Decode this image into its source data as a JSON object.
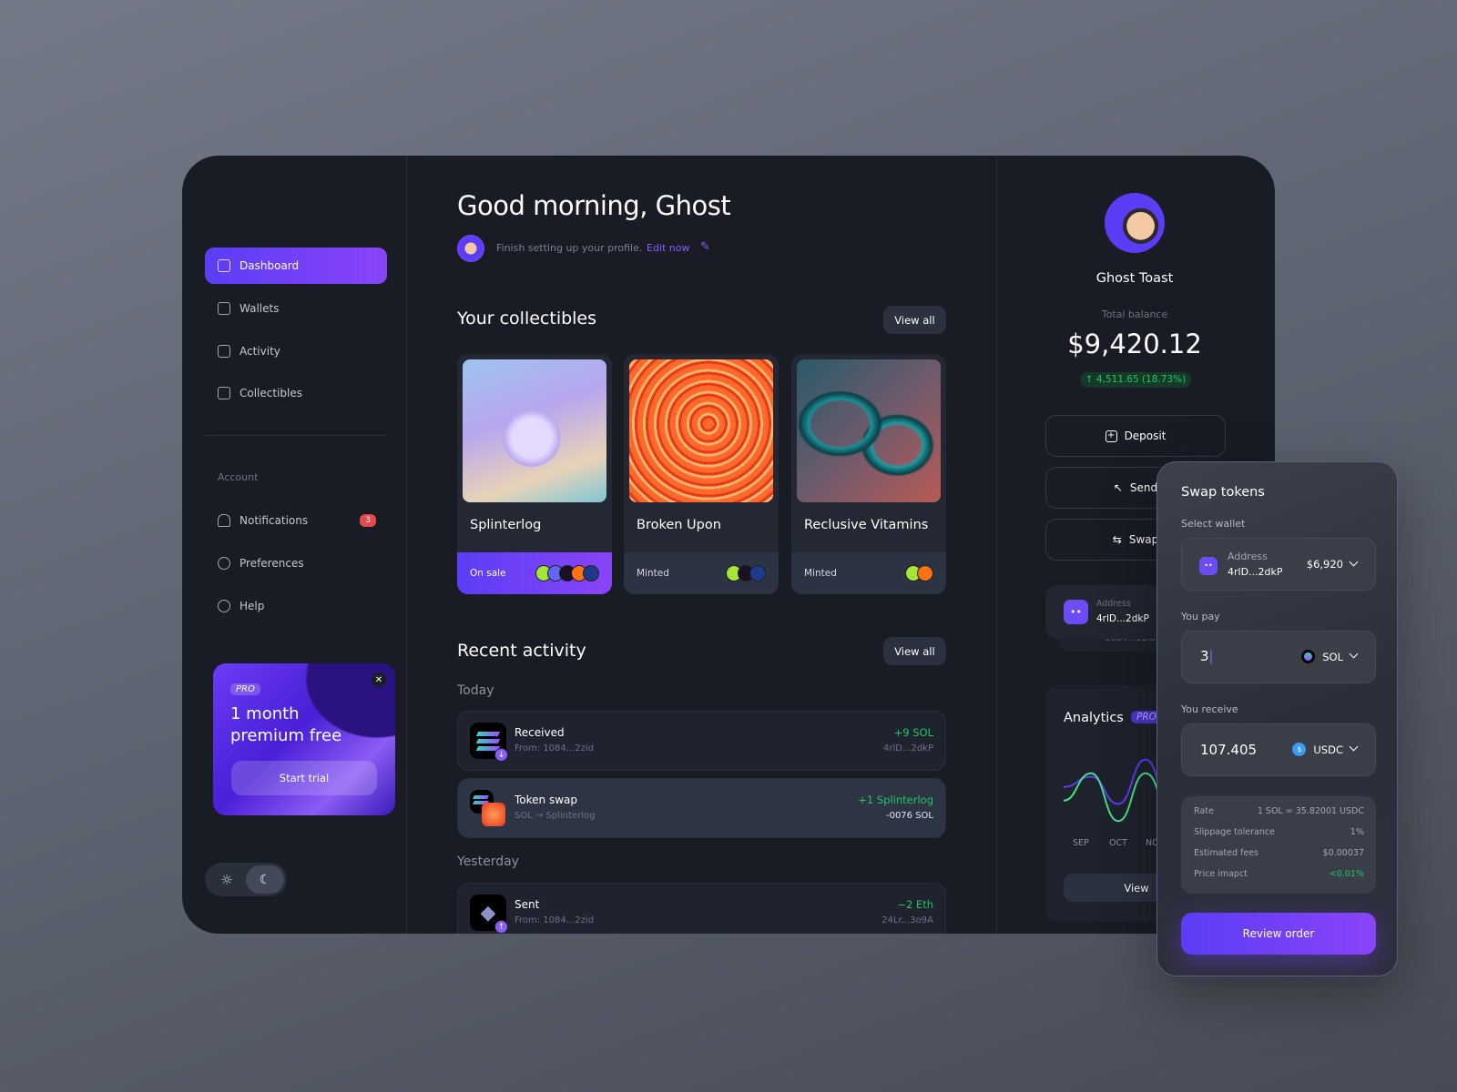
{
  "sidebar": {
    "items": [
      {
        "label": "Dashboard",
        "icon": "grid-icon",
        "active": true
      },
      {
        "label": "Wallets",
        "icon": "wallet-icon"
      },
      {
        "label": "Activity",
        "icon": "chart-icon"
      },
      {
        "label": "Collectibles",
        "icon": "image-icon"
      }
    ],
    "account_label": "Account",
    "account_items": [
      {
        "label": "Notifications",
        "icon": "bell-icon",
        "badge": "3"
      },
      {
        "label": "Preferences",
        "icon": "gear-icon"
      },
      {
        "label": "Help",
        "icon": "info-icon"
      }
    ],
    "promo": {
      "tag": "PRO",
      "title": "1 month premium free",
      "button": "Start trial"
    },
    "theme": {
      "light_icon": "sun-icon",
      "dark_icon": "moon-icon",
      "selected": "dark"
    }
  },
  "main": {
    "greeting": "Good morning, Ghost",
    "profile_hint": "Finish setting up your profile.",
    "edit_link": "Edit now",
    "collectibles": {
      "title": "Your collectibles",
      "view_all": "View all",
      "items": [
        {
          "name": "Splinterlog",
          "status": "On sale"
        },
        {
          "name": "Broken Upon",
          "status": "Minted"
        },
        {
          "name": "Reclusive Vitamins",
          "status": "Minted"
        }
      ]
    },
    "activity": {
      "title": "Recent activity",
      "view_all": "View all",
      "today": "Today",
      "yesterday": "Yesterday",
      "rows": [
        {
          "title": "Received",
          "sub": "From: 1084...2zid",
          "amount": "+9 SOL",
          "address": "4rlD...2dkP"
        },
        {
          "title": "Token swap",
          "sub": "SOL → Splinterlog",
          "amount": "+1 Splinterlog",
          "address": "-0076 SOL"
        },
        {
          "title": "Sent",
          "sub": "From: 1084...2zid",
          "amount": "−2 Eth",
          "address": "24Lr...3o9A"
        }
      ]
    }
  },
  "profile": {
    "name": "Ghost Toast",
    "balance_label": "Total balance",
    "balance": "$9,420.12",
    "change": "4,511.65 (18.73%)",
    "actions": [
      "Deposit",
      "Send",
      "Swap"
    ],
    "wallet": {
      "label": "Address",
      "address": "4rlD...2dkP",
      "behind": "1084...2zid"
    },
    "analytics": {
      "title": "Analytics",
      "tag": "PRO",
      "view": "View"
    }
  },
  "chart_data": {
    "type": "line",
    "categories": [
      "SEP",
      "OCT",
      "NOV"
    ],
    "series": [
      {
        "values": [
          0.55,
          0.7,
          0.3,
          0.95,
          0.15,
          0.6
        ]
      },
      {
        "values": [
          0.35,
          0.75,
          0.05,
          0.75,
          0.1,
          0.55
        ]
      }
    ],
    "colors": [
      "#5b3df5",
      "#4ade80"
    ]
  },
  "swap": {
    "title": "Swap tokens",
    "select_wallet": "Select wallet",
    "wallet_label": "Address",
    "wallet_address": "4rlD...2dkP",
    "wallet_value": "$6,920",
    "pay_label": "You pay",
    "pay_value": "3",
    "pay_token": "SOL",
    "receive_label": "You receive",
    "receive_value": "107.405",
    "receive_token": "USDC",
    "details": [
      {
        "k": "Rate",
        "v": "1 SOL = 35.82001 USDC"
      },
      {
        "k": "Slippage tolerance",
        "v": "1%"
      },
      {
        "k": "Estimated fees",
        "v": "$0.00037"
      },
      {
        "k": "Price imapct",
        "v": "<0.01%",
        "positive": true
      }
    ],
    "review": "Review order"
  },
  "colors": {
    "accent": "#6d40f7",
    "positive": "#22c55e",
    "badge": "#e5484d"
  }
}
